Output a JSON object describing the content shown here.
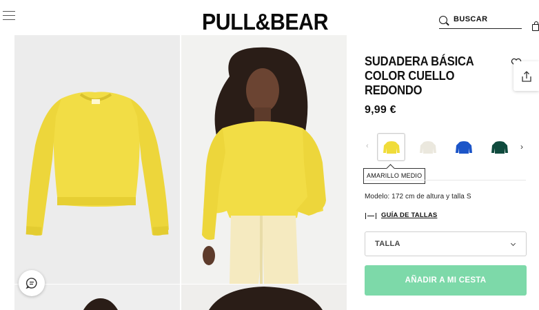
{
  "header": {
    "logo": "PULL&BEAR",
    "search_label": "BUSCAR"
  },
  "product": {
    "title": "SUDADERA BÁSICA COLOR CUELLO REDONDO",
    "price": "9,99 €",
    "selected_color": "AMARILLO MEDIO",
    "model_info": "Modelo: 172 cm de altura y talla S",
    "size_guide_label": "GUÍA DE TALLAS",
    "size_select_label": "TALLA",
    "add_to_cart_label": "AÑADIR A MI CESTA",
    "swatches": [
      {
        "color": "#f0dc3a",
        "selected": true
      },
      {
        "color": "#ebe8de",
        "selected": false
      },
      {
        "color": "#1c55c8",
        "selected": false
      },
      {
        "color": "#0f4a3d",
        "selected": false
      }
    ]
  },
  "colors": {
    "accent_button": "#7dd9a9",
    "product_yellow": "#f2dd45"
  }
}
